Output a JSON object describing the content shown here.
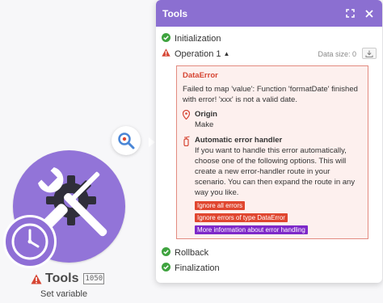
{
  "module": {
    "name": "Tools",
    "badge": "1050",
    "subtitle": "Set variable",
    "main_icon": "wrench-gear-icon",
    "trigger_icon": "clock-icon",
    "inspector_icon": "magnifier-icon",
    "warning_icon": "warning-icon",
    "color": "#9274d8"
  },
  "panel": {
    "title": "Tools",
    "header_color": "#8b6fd1",
    "expand_icon": "expand-icon",
    "close_icon": "close-icon",
    "rows": {
      "initialization": "Initialization",
      "operation": "Operation 1",
      "rollback": "Rollback",
      "finalization": "Finalization"
    },
    "data_size_label": "Data size: 0",
    "download_icon": "download-icon",
    "error": {
      "type": "DataError",
      "message": "Failed to map 'value': Function 'formatDate' finished with error! 'xxx' is not a valid date.",
      "origin_label": "Origin",
      "origin_value": "Make",
      "handler_label": "Automatic error handler",
      "handler_text": "If you want to handle this error automatically, choose one of the following options. This will create a new error-handler route in your scenario. You can then expand the route in any way you like.",
      "buttons": {
        "ignore_all": "Ignore all errors",
        "ignore_type": "Ignore errors of type DataError",
        "more_info": "More information about error handling"
      }
    }
  }
}
